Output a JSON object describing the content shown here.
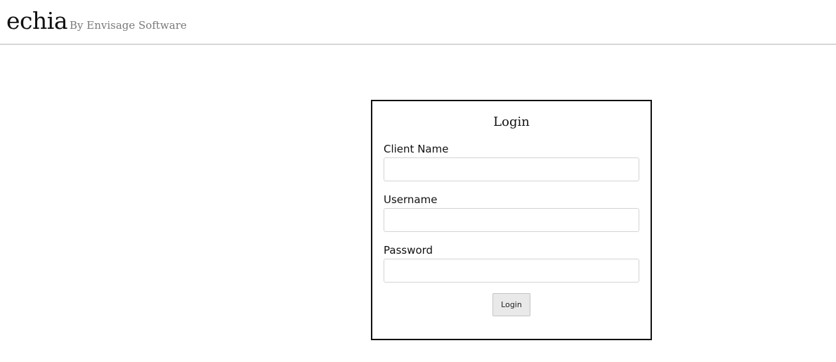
{
  "header": {
    "brand": "echia",
    "byline": "By Envisage Software"
  },
  "login": {
    "title": "Login",
    "fields": [
      {
        "label": "Client Name",
        "value": "",
        "placeholder": ""
      },
      {
        "label": "Username",
        "value": "",
        "placeholder": ""
      },
      {
        "label": "Password",
        "value": "",
        "placeholder": ""
      }
    ],
    "submit_label": "Login"
  }
}
